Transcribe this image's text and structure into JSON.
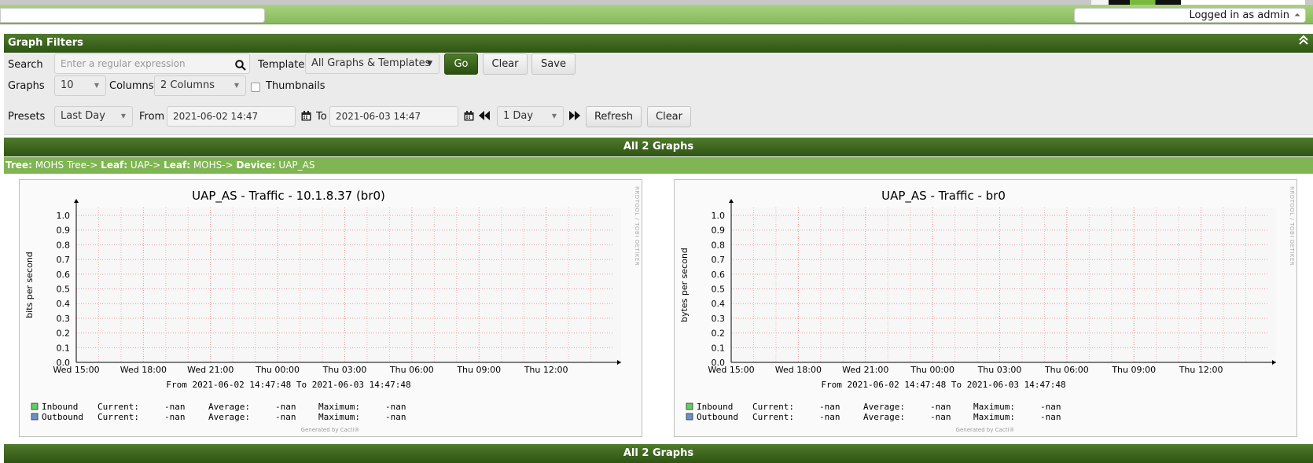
{
  "header": {
    "user_label": "Logged in as admin",
    "user_caret": "⏶"
  },
  "filters": {
    "title": "Graph Filters",
    "collapse_icon": "double-chevron-up-icon",
    "search_label": "Search",
    "search_placeholder": "Enter a regular expression",
    "template_label": "Template",
    "template_value": "All Graphs & Templates",
    "go_label": "Go",
    "clear_label": "Clear",
    "save_label": "Save",
    "graphs_label": "Graphs",
    "graphs_value": "10",
    "columns_label": "Columns",
    "columns_value": "2 Columns",
    "thumbnails_label": "Thumbnails",
    "thumbnails_checked": false,
    "presets_label": "Presets",
    "presets_value": "Last Day",
    "from_label": "From",
    "from_value": "2021-06-02 14:47",
    "to_label": "To",
    "to_value": "2021-06-03 14:47",
    "span_value": "1 Day",
    "refresh_label": "Refresh",
    "clear2_label": "Clear"
  },
  "section": {
    "title": "All 2 Graphs",
    "bottom_title": "All 2 Graphs"
  },
  "tree": {
    "tree_key": "Tree:",
    "tree_val": "MOHS Tree->",
    "leaf1_key": "Leaf:",
    "leaf1_val": "UAP->",
    "leaf2_key": "Leaf:",
    "leaf2_val": "MOHS->",
    "device_key": "Device:",
    "device_val": "UAP_AS"
  },
  "graphs": [
    {
      "title": "UAP_AS - Traffic - 10.1.8.37 (br0)",
      "ylabel": "bits per second",
      "side_text": "RRDTOOL / TOBI OETIKER",
      "range_text": "From 2021-06-02 14:47:48 To 2021-06-03 14:47:48",
      "generated": "Generated by Cacti®",
      "legend": [
        {
          "name": "Inbound",
          "color": "#5fcf5f",
          "current": "Current:",
          "cur_val": "-nan",
          "average": "Average:",
          "avg_val": "-nan",
          "maximum": "Maximum:",
          "max_val": "-nan"
        },
        {
          "name": "Outbound",
          "color": "#6b8fc9",
          "current": "Current:",
          "cur_val": "-nan",
          "average": "Average:",
          "avg_val": "-nan",
          "maximum": "Maximum:",
          "max_val": "-nan"
        }
      ]
    },
    {
      "title": "UAP_AS - Traffic - br0",
      "ylabel": "bytes per second",
      "side_text": "RRDTOOL / TOBI OETIKER",
      "range_text": "From 2021-06-02 14:47:48 To 2021-06-03 14:47:48",
      "generated": "Generated by Cacti®",
      "legend": [
        {
          "name": "Inbound",
          "color": "#5fcf5f",
          "current": "Current:",
          "cur_val": "-nan",
          "average": "Average:",
          "avg_val": "-nan",
          "maximum": "Maximum:",
          "max_val": "-nan"
        },
        {
          "name": "Outbound",
          "color": "#6b8fc9",
          "current": "Current:",
          "cur_val": "-nan",
          "average": "Average:",
          "avg_val": "-nan",
          "maximum": "Maximum:",
          "max_val": "-nan"
        }
      ]
    }
  ],
  "axis": {
    "y_ticks": [
      "0.0",
      "0.1",
      "0.2",
      "0.3",
      "0.4",
      "0.5",
      "0.6",
      "0.7",
      "0.8",
      "0.9",
      "1.0"
    ],
    "x_ticks": [
      "Wed 15:00",
      "Wed 18:00",
      "Wed 21:00",
      "Thu 00:00",
      "Thu 03:00",
      "Thu 06:00",
      "Thu 09:00",
      "Thu 12:00"
    ]
  }
}
